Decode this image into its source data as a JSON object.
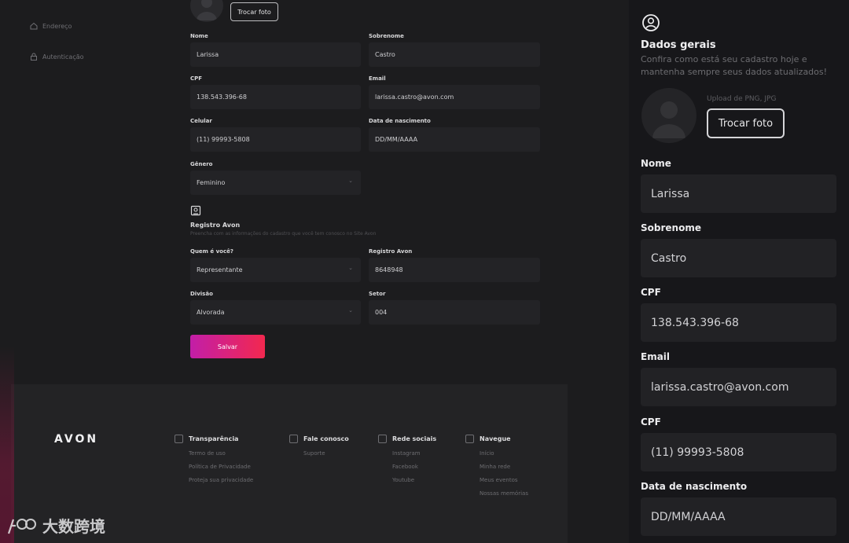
{
  "sidebar": {
    "items": [
      {
        "label": "Endereço",
        "icon": "home-icon"
      },
      {
        "label": "Autenticação",
        "icon": "lock-icon"
      }
    ]
  },
  "profile": {
    "change_photo": "Trocar foto"
  },
  "form": {
    "nome": {
      "label": "Nome",
      "value": "Larissa"
    },
    "sobrenome": {
      "label": "Sobrenome",
      "value": "Castro"
    },
    "cpf": {
      "label": "CPF",
      "value": "138.543.396-68"
    },
    "email": {
      "label": "Email",
      "value": "larissa.castro@avon.com"
    },
    "celular": {
      "label": "Celular",
      "value": "(11) 99993-5808"
    },
    "nascimento": {
      "label": "Data de nascimento",
      "value": "DD/MM/AAAA"
    },
    "genero": {
      "label": "Gênero",
      "value": "Feminino"
    }
  },
  "registro": {
    "title": "Registro Avon",
    "subtitle": "Preencha com as informações do cadastro que você tem conosco no Site Avon",
    "quem": {
      "label": "Quem é você?",
      "value": "Representante"
    },
    "registro_avon": {
      "label": "Registro Avon",
      "value": "8648948"
    },
    "divisao": {
      "label": "Divisão",
      "value": "Alvorada"
    },
    "setor": {
      "label": "Setor",
      "value": "004"
    },
    "save_label": "Salvar"
  },
  "footer": {
    "brand": "AVON",
    "columns": [
      {
        "title": "Transparência",
        "links": [
          "Termo de uso",
          "Política de Privacidade",
          "Proteja sua privacidade"
        ]
      },
      {
        "title": "Fale conosco",
        "links": [
          "Suporte"
        ]
      },
      {
        "title": "Rede sociais",
        "links": [
          "Instagram",
          "Facebook",
          "Youtube"
        ]
      },
      {
        "title": "Navegue",
        "links": [
          "Início",
          "Minha rede",
          "Meus eventos",
          "Nossas memórias"
        ]
      }
    ]
  },
  "panel": {
    "title": "Dados gerais",
    "description_line1": "Confira como está seu cadastro hoje e",
    "description_line2": "mantenha sempre seus dados atualizados!",
    "upload_hint": "Upload de PNG, JPG",
    "change_photo": "Trocar foto",
    "fields": [
      {
        "label": "Nome",
        "value": "Larissa"
      },
      {
        "label": "Sobrenome",
        "value": "Castro"
      },
      {
        "label": "CPF",
        "value": "138.543.396-68"
      },
      {
        "label": "Email",
        "value": "larissa.castro@avon.com"
      },
      {
        "label": "CPF",
        "value": "(11) 99993-5808"
      },
      {
        "label": "Data de nascimento",
        "value": "DD/MM/AAAA"
      }
    ]
  },
  "watermark": {
    "text": "大数跨境"
  },
  "colors": {
    "accent_start": "#c21ea8",
    "accent_end": "#f2284f",
    "background": "#1b1b1d"
  }
}
